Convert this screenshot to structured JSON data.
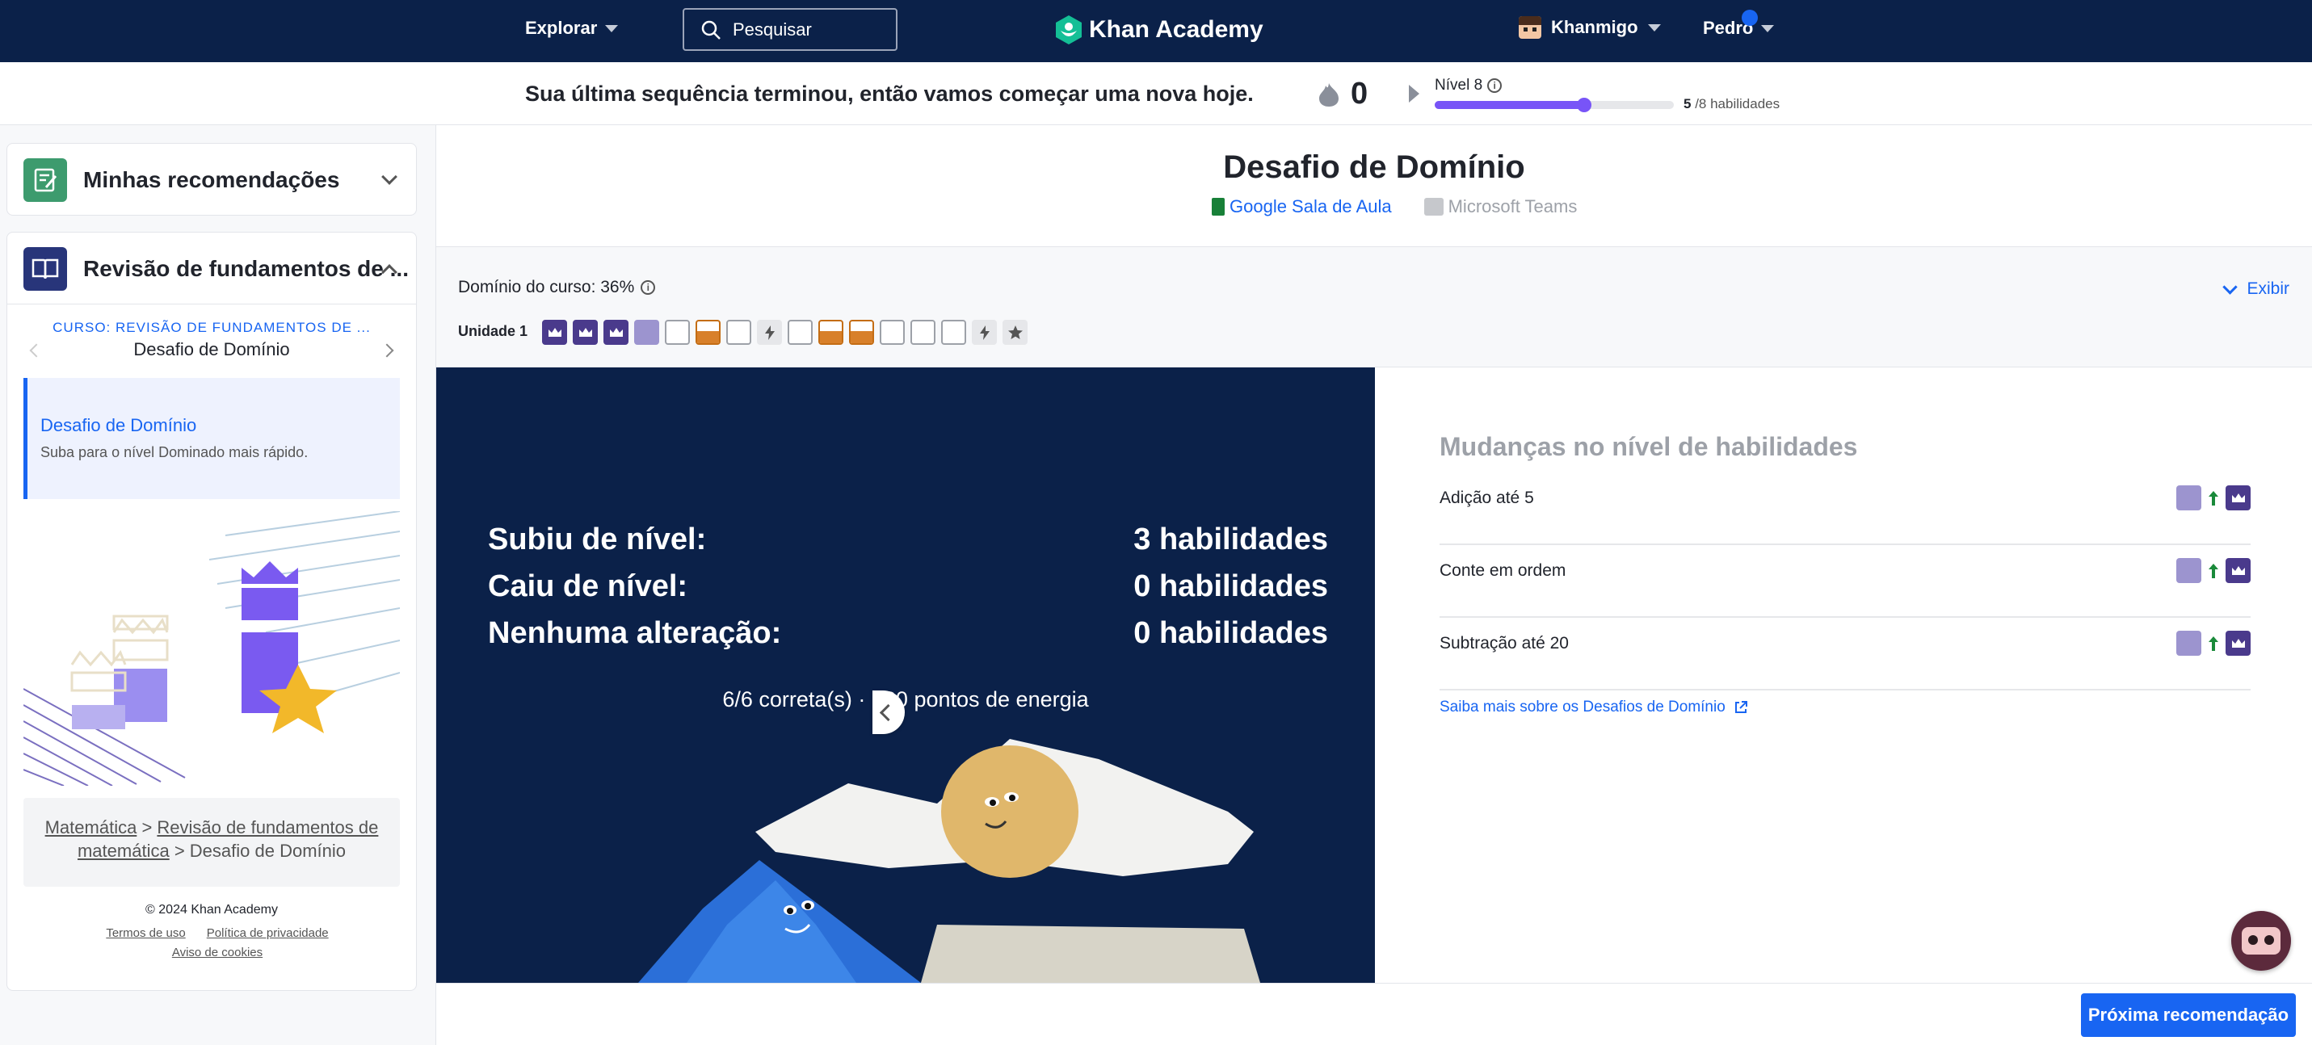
{
  "nav": {
    "explore": "Explorar",
    "search_placeholder": "Pesquisar",
    "logo": "Khan Academy",
    "khanmigo": "Khanmigo",
    "user": "Pedro"
  },
  "streak": {
    "message": "Sua última sequência terminou, então vamos começar uma nova hoje.",
    "count": "0",
    "level_label": "Nível 8",
    "level_done": "5",
    "level_total": "/8 habilidades",
    "level_progress": 0.625
  },
  "sidebar": {
    "recommendations": "Minhas recomendações",
    "course_card": "Revisão de fundamentos de ...",
    "course_label": "CURSO: REVISÃO DE FUNDAMENTOS DE ...",
    "course_item_title": "Desafio de Domínio",
    "active_item": {
      "title": "Desafio de Domínio",
      "subtitle": "Suba para o nível Dominado mais rápido."
    },
    "breadcrumb": {
      "math": "Matemática",
      "sep1": " > ",
      "review": "Revisão de fundamentos de matemática",
      "sep2": " > ",
      "current": "Desafio de Domínio"
    },
    "copyright": "© 2024 Khan Academy",
    "footer_links": [
      "Termos de uso",
      "Política de privacidade",
      "Aviso de cookies"
    ]
  },
  "main": {
    "title": "Desafio de Domínio",
    "share_google": "Google Sala de Aula",
    "share_teams": "Microsoft Teams",
    "course_mastery": "Domínio do curso: 36%",
    "show": "Exibir",
    "unit_label": "Unidade 1",
    "skills": [
      "mastered",
      "mastered",
      "mastered",
      "proficient",
      "attempted",
      "familiar",
      "attempted",
      "quiz",
      "attempted",
      "familiar",
      "familiar",
      "attempted",
      "attempted",
      "attempted",
      "quiz",
      "test"
    ]
  },
  "results": {
    "rows": [
      {
        "label": "Subiu de nível:",
        "value": "3 habilidades"
      },
      {
        "label": "Caiu de nível:",
        "value": "0 habilidades"
      },
      {
        "label": "Nenhuma alteração:",
        "value": "0 habilidades"
      }
    ],
    "summary": "6/6 correta(s) · 280 pontos de energia"
  },
  "changes": {
    "title": "Mudanças no nível de habilidades",
    "items": [
      {
        "name": "Adição até 5"
      },
      {
        "name": "Conte em ordem"
      },
      {
        "name": "Subtração até 20"
      }
    ],
    "learn_more": "Saiba mais sobre os Desafios de Domínio"
  },
  "footer": {
    "next": "Próxima recomendação"
  },
  "colors": {
    "nav_bg": "#0b2149",
    "accent": "#1865f2",
    "mastered": "#4a3a8c",
    "proficient": "#9c94cf",
    "familiar": "#d8802a",
    "level": "#7854f7"
  }
}
